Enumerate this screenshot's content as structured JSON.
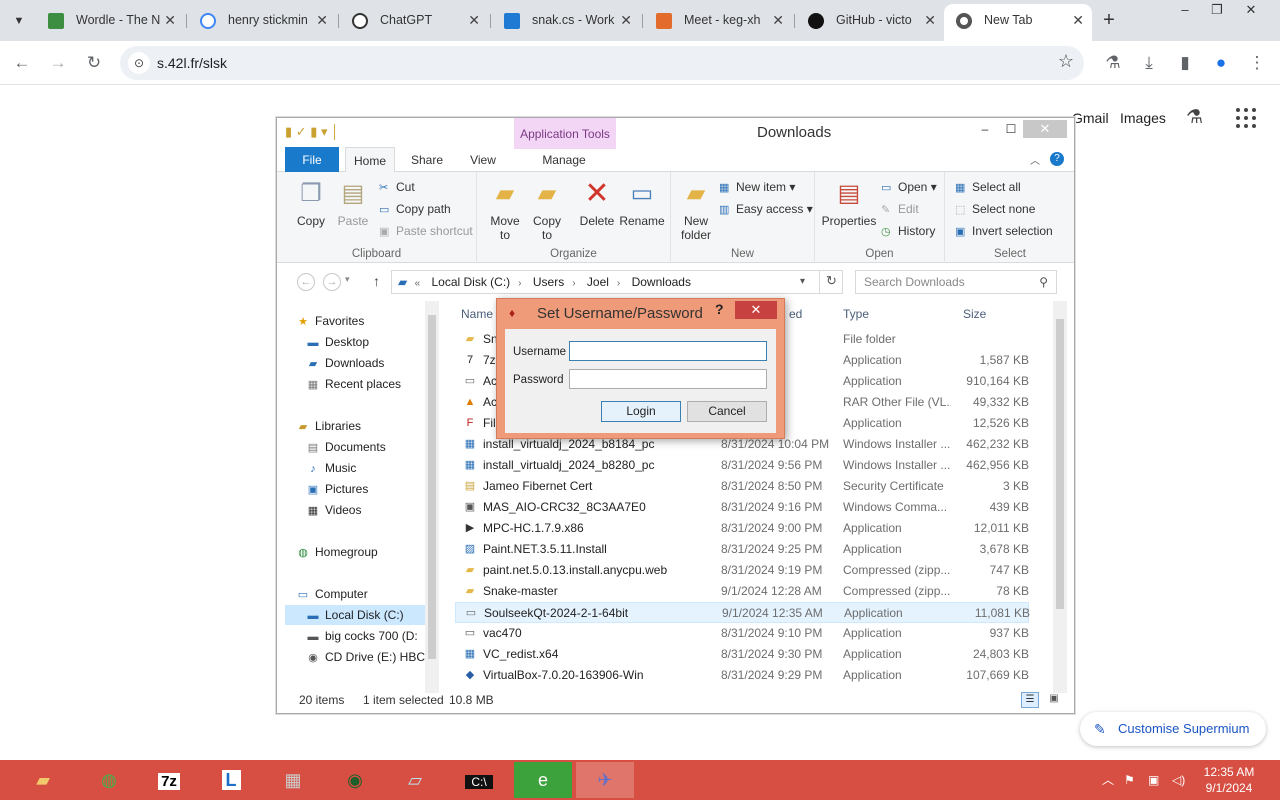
{
  "browser": {
    "tabs": [
      {
        "title": "Wordle - The N",
        "favicon": "wordle-grid-icon",
        "color": "#3e8e41"
      },
      {
        "title": "henry stickmin",
        "favicon": "google-g-icon",
        "color": "#4285f4"
      },
      {
        "title": "ChatGPT",
        "favicon": "openai-icon",
        "color": "#333333"
      },
      {
        "title": "snak.cs - Work",
        "favicon": "vscode-icon",
        "color": "#1e7ad3"
      },
      {
        "title": "Meet - keg-xh",
        "favicon": "meet-icon",
        "color": "#e36b2c"
      },
      {
        "title": "GitHub - victo",
        "favicon": "github-icon",
        "color": "#111111"
      },
      {
        "title": "New Tab",
        "favicon": "chrome-icon",
        "color": "#555555"
      }
    ],
    "url": "s.42l.fr/slsk"
  },
  "ntp": {
    "gmail": "Gmail",
    "images": "Images",
    "customise": "Customise Supermium"
  },
  "explorer": {
    "title": "Downloads",
    "app_tools": "Application Tools",
    "ribbon_tabs": {
      "file": "File",
      "home": "Home",
      "share": "Share",
      "view": "View",
      "manage": "Manage"
    },
    "clipboard": {
      "copy": "Copy",
      "paste": "Paste",
      "cut": "Cut",
      "copy_path": "Copy path",
      "paste_shortcut": "Paste shortcut",
      "label": "Clipboard"
    },
    "organize": {
      "move_to": "Move to",
      "copy_to": "Copy to",
      "delete": "Delete",
      "rename": "Rename",
      "label": "Organize"
    },
    "new": {
      "new_folder": "New folder",
      "new_item": "New item",
      "easy_access": "Easy access",
      "label": "New"
    },
    "open": {
      "properties": "Properties",
      "open": "Open",
      "edit": "Edit",
      "history": "History",
      "label": "Open"
    },
    "select": {
      "select_all": "Select all",
      "select_none": "Select none",
      "invert": "Invert selection",
      "label": "Select"
    },
    "breadcrumb": [
      "Local Disk (C:)",
      "Users",
      "Joel",
      "Downloads"
    ],
    "search_placeholder": "Search Downloads",
    "nav": [
      {
        "label": "Favorites",
        "icon": "star-icon",
        "color": "#e0a100"
      },
      {
        "label": "Desktop",
        "icon": "desktop-icon",
        "color": "#2a6fb5"
      },
      {
        "label": "Downloads",
        "icon": "downloads-folder-icon",
        "color": "#2a6fb5"
      },
      {
        "label": "Recent places",
        "icon": "recent-places-icon",
        "color": "#777777"
      },
      {
        "label": "Libraries",
        "icon": "libraries-icon",
        "color": "#c69a2c"
      },
      {
        "label": "Documents",
        "icon": "documents-icon",
        "color": "#777777"
      },
      {
        "label": "Music",
        "icon": "music-icon",
        "color": "#2a6fb5"
      },
      {
        "label": "Pictures",
        "icon": "pictures-icon",
        "color": "#2a6fb5"
      },
      {
        "label": "Videos",
        "icon": "videos-icon",
        "color": "#333333"
      },
      {
        "label": "Homegroup",
        "icon": "homegroup-icon",
        "color": "#2a8a3a"
      },
      {
        "label": "Computer",
        "icon": "computer-icon",
        "color": "#2a6fb5"
      },
      {
        "label": "Local Disk (C:)",
        "icon": "drive-icon",
        "color": "#2a6fb5"
      },
      {
        "label": "big cocks 700 (D:",
        "icon": "drive-icon",
        "color": "#555555"
      },
      {
        "label": "CD Drive (E:) HBC",
        "icon": "cd-drive-icon",
        "color": "#555555"
      }
    ],
    "columns": {
      "name": "Name",
      "date": "ed",
      "type": "Type",
      "size": "Size"
    },
    "files": [
      {
        "name": "Sna",
        "date": "36 PM",
        "type": "File folder",
        "size": "",
        "icon": "folder-icon",
        "color": "#e6b84a"
      },
      {
        "name": "7z",
        "date": "0:12 PM",
        "type": "Application",
        "size": "1,587 KB",
        "icon": "7zip-icon",
        "color": "#222222"
      },
      {
        "name": "Ac",
        "date": "0:17 PM",
        "type": "Application",
        "size": "910,164 KB",
        "icon": "app-icon",
        "color": "#666666"
      },
      {
        "name": "Ac",
        "date": "0:14 PM",
        "type": "RAR Other File (VL...",
        "size": "49,332 KB",
        "icon": "vlc-icon",
        "color": "#e07b00"
      },
      {
        "name": "Fil",
        "date": "56 PM",
        "type": "Application",
        "size": "12,526 KB",
        "icon": "filezilla-icon",
        "color": "#bf1e1e"
      },
      {
        "name": "install_virtualdj_2024_b8184_pc",
        "date": "8/31/2024 10:04 PM",
        "type": "Windows Installer ...",
        "size": "462,232 KB",
        "icon": "installer-icon",
        "color": "#2a6fb5"
      },
      {
        "name": "install_virtualdj_2024_b8280_pc",
        "date": "8/31/2024 9:56 PM",
        "type": "Windows Installer ...",
        "size": "462,956 KB",
        "icon": "installer-icon",
        "color": "#2a6fb5"
      },
      {
        "name": "Jameo Fibernet Cert",
        "date": "8/31/2024 8:50 PM",
        "type": "Security Certificate",
        "size": "3 KB",
        "icon": "certificate-icon",
        "color": "#c9a23a"
      },
      {
        "name": "MAS_AIO-CRC32_8C3AA7E0",
        "date": "8/31/2024 9:16 PM",
        "type": "Windows Comma...",
        "size": "439 KB",
        "icon": "cmd-file-icon",
        "color": "#555555"
      },
      {
        "name": "MPC-HC.1.7.9.x86",
        "date": "8/31/2024 9:00 PM",
        "type": "Application",
        "size": "12,011 KB",
        "icon": "mpc-icon",
        "color": "#333333"
      },
      {
        "name": "Paint.NET.3.5.11.Install",
        "date": "8/31/2024 9:25 PM",
        "type": "Application",
        "size": "3,678 KB",
        "icon": "paintnet-icon",
        "color": "#2a6fb5"
      },
      {
        "name": "paint.net.5.0.13.install.anycpu.web",
        "date": "8/31/2024 9:19 PM",
        "type": "Compressed (zipp...",
        "size": "747 KB",
        "icon": "zip-icon",
        "color": "#e6b84a"
      },
      {
        "name": "Snake-master",
        "date": "9/1/2024 12:28 AM",
        "type": "Compressed (zipp...",
        "size": "78 KB",
        "icon": "zip-icon",
        "color": "#e6b84a"
      },
      {
        "name": "SoulseekQt-2024-2-1-64bit",
        "date": "9/1/2024 12:35 AM",
        "type": "Application",
        "size": "11,081 KB",
        "icon": "soulseek-icon",
        "color": "#666666"
      },
      {
        "name": "vac470",
        "date": "8/31/2024 9:10 PM",
        "type": "Application",
        "size": "937 KB",
        "icon": "app-icon",
        "color": "#555555"
      },
      {
        "name": "VC_redist.x64",
        "date": "8/31/2024 9:30 PM",
        "type": "Application",
        "size": "24,803 KB",
        "icon": "installer-icon",
        "color": "#2a6fb5"
      },
      {
        "name": "VirtualBox-7.0.20-163906-Win",
        "date": "8/31/2024 9:29 PM",
        "type": "Application",
        "size": "107,669 KB",
        "icon": "virtualbox-icon",
        "color": "#2a5fa8"
      }
    ],
    "status": {
      "count": "20 items",
      "selected": "1 item selected",
      "size": "10.8 MB"
    }
  },
  "dialog": {
    "title": "Set Username/Password",
    "help": "?",
    "username_label": "Username",
    "password_label": "Password",
    "username_value": "",
    "password_value": "",
    "login": "Login",
    "cancel": "Cancel"
  },
  "taskbar": {
    "apps": [
      "file-explorer-icon",
      "globe-browser-icon",
      "7zip-icon",
      "lync-icon",
      "network-app-icon",
      "steam-like-icon",
      "notepad-icon",
      "command-prompt-icon",
      "internet-explorer-icon",
      "bird-app-icon"
    ],
    "time": "12:35 AM",
    "date": "9/1/2024"
  }
}
